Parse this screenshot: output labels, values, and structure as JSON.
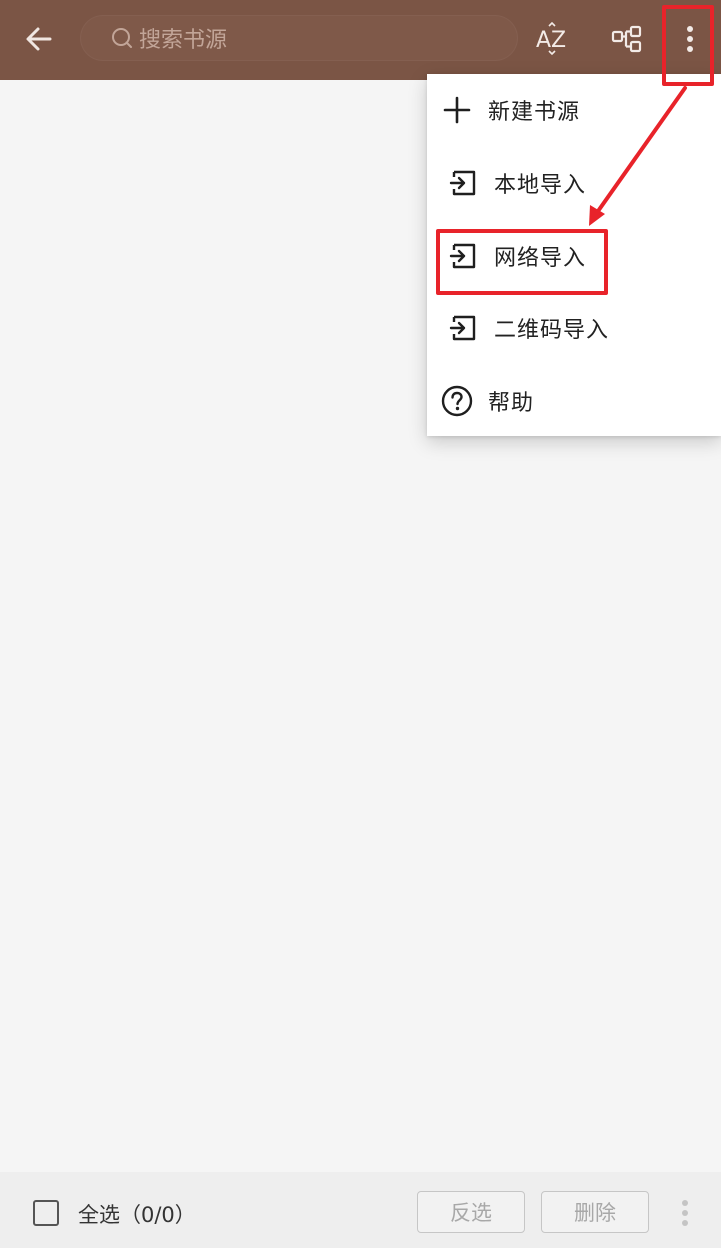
{
  "colors": {
    "appbar": "#7b5545",
    "highlight": "#e8232a",
    "background": "#f5f5f5",
    "menu_bg": "#ffffff"
  },
  "appbar": {
    "back_icon": "arrow-left-icon",
    "search_placeholder": "搜索书源",
    "search_icon": "search-icon",
    "sort_label": "AZ",
    "sort_icon": "sort-az-icon",
    "group_icon": "group-icon",
    "more_icon": "more-vertical-icon"
  },
  "menu": {
    "items": [
      {
        "label": "新建书源",
        "icon": "plus-icon"
      },
      {
        "label": "本地导入",
        "icon": "import-icon"
      },
      {
        "label": "网络导入",
        "icon": "import-icon"
      },
      {
        "label": "二维码导入",
        "icon": "import-icon"
      },
      {
        "label": "帮助",
        "icon": "help-circle-icon"
      }
    ]
  },
  "bottombar": {
    "select_all_label": "全选（0/0）",
    "invert_label": "反选",
    "delete_label": "删除",
    "more_icon": "more-vertical-icon"
  }
}
